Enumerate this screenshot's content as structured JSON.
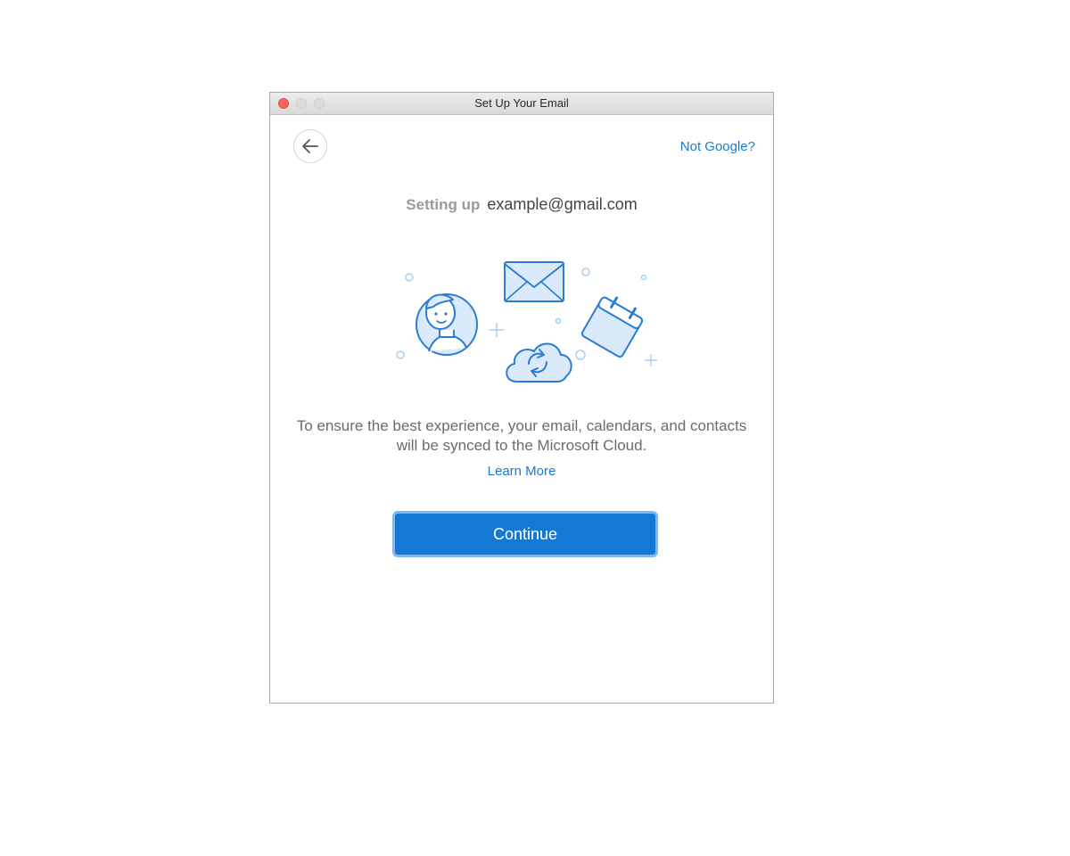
{
  "window": {
    "title": "Set Up Your Email"
  },
  "header": {
    "back_icon": "arrow-left-icon",
    "not_provider_link": "Not Google?"
  },
  "setup": {
    "label": "Setting up",
    "email": "example@gmail.com"
  },
  "illustration": {
    "icons": [
      "person-avatar-icon",
      "envelope-icon",
      "calendar-icon",
      "cloud-sync-icon"
    ]
  },
  "message": {
    "text": "To ensure the best experience, your email, calendars, and contacts will be synced to the Microsoft Cloud.",
    "learn_more": "Learn More"
  },
  "actions": {
    "continue_label": "Continue"
  },
  "colors": {
    "accent": "#1478d4",
    "link": "#1a7ad4",
    "illustration_stroke": "#2b7cd3",
    "illustration_fill": "#dbeafa"
  }
}
